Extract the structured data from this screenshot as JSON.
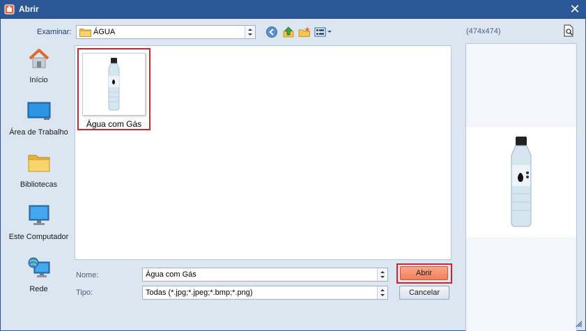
{
  "window": {
    "title": "Abrir",
    "close_glyph": "✕"
  },
  "toolbar": {
    "look_in_label": "Examinar:",
    "look_in_value": "ÁGUA",
    "icons": [
      "back-icon",
      "up-folder-icon",
      "new-folder-icon",
      "view-menu-icon"
    ]
  },
  "places": [
    {
      "label": "Início",
      "icon": "home-icon"
    },
    {
      "label": "Área de Trabalho",
      "icon": "desktop-icon"
    },
    {
      "label": "Bibliotecas",
      "icon": "libraries-icon"
    },
    {
      "label": "Este Computador",
      "icon": "computer-icon"
    },
    {
      "label": "Rede",
      "icon": "network-icon"
    }
  ],
  "files": [
    {
      "name": "Água com Gás",
      "selected": true
    }
  ],
  "form": {
    "name_label": "Nome:",
    "name_value": "Água com Gás",
    "type_label": "Tipo:",
    "type_value": "Todas (*.jpg;*.jpeg;*.bmp;*.png)"
  },
  "buttons": {
    "open": "Abrir",
    "cancel": "Cancelar"
  },
  "preview": {
    "dimensions": "(474x474)"
  },
  "colors": {
    "titlebar": "#2b5797",
    "highlight": "#d2232a",
    "open_button": "#f07e5c"
  }
}
